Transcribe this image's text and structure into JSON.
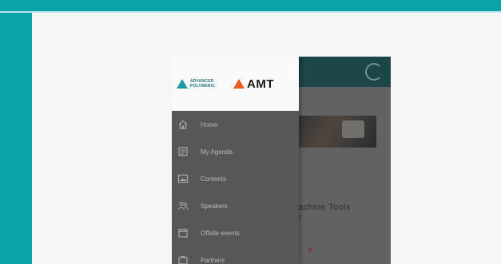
{
  "drawer": {
    "logo_left": "ADVANCED POLYMERIC",
    "logo_right": "AMT",
    "items": [
      {
        "label": "Home",
        "icon": "home-icon"
      },
      {
        "label": "My Agenda",
        "icon": "agenda-icon"
      },
      {
        "label": "Contents",
        "icon": "contents-icon"
      },
      {
        "label": "Speakers",
        "icon": "speakers-icon"
      },
      {
        "label": "Offsite events",
        "icon": "events-icon"
      },
      {
        "label": "Partners",
        "icon": "partners-icon"
      }
    ]
  },
  "content": {
    "card_title": "achine Tools",
    "card_sub": "r"
  },
  "colors": {
    "accent": "#0aa3a8",
    "app_header": "#0b4c4f",
    "drawer_bg": "#575757",
    "amt_orange": "#e85b1f"
  }
}
